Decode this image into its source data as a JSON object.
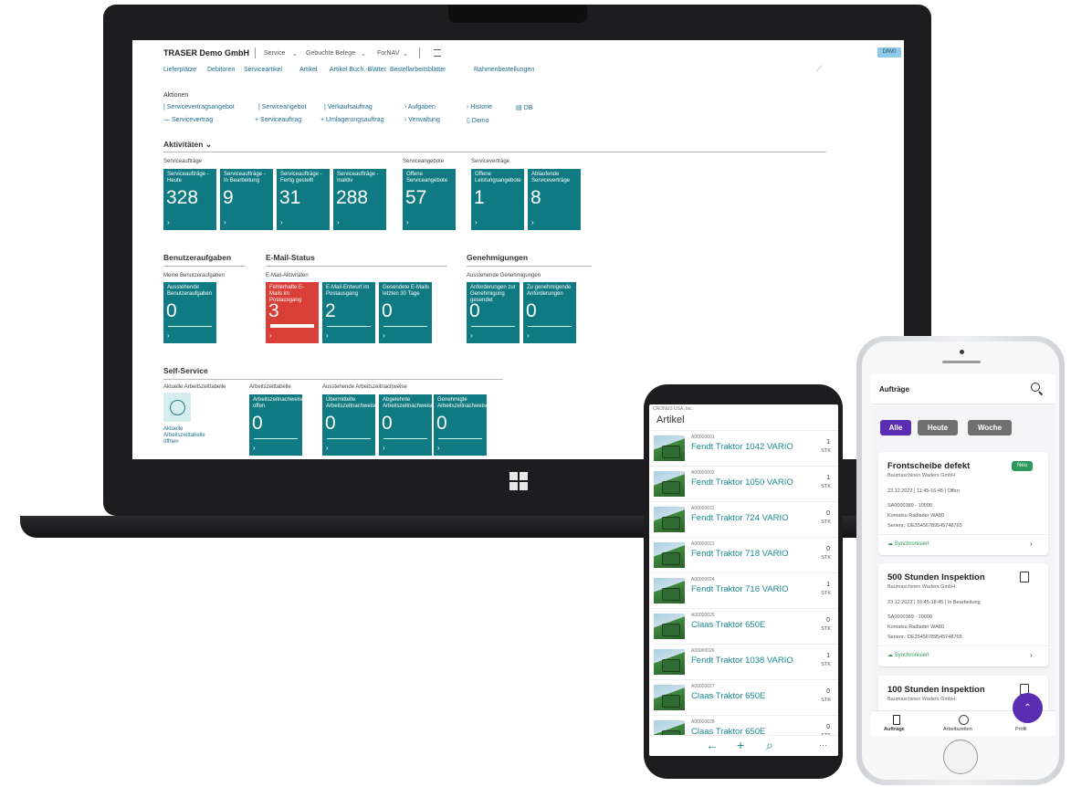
{
  "laptop": {
    "company": "TRASER Demo GmbH",
    "topmenu": [
      "Service",
      "Gebuchte Belege",
      "ForNAV"
    ],
    "badge": "DfW0",
    "navlinks": [
      "Lieferplätze",
      "Debitoren",
      "Serviceartikel",
      "Artikel",
      "Artikel Buch.-Blätter",
      "Bestellarbeitsblätter",
      "Rahmenbestellungen"
    ],
    "actions_title": "Aktionen",
    "actions_row1": [
      "Servicevertragsangebot",
      "Serviceangebot",
      "Verkaufsauftrag",
      "Aufgaben",
      "Historie",
      "DB"
    ],
    "actions_row2": [
      "Servicevertrag",
      "Serviceauftrag",
      "Umlagerungsauftrag",
      "Verwaltung",
      "Demo"
    ],
    "activities_title": "Aktivitäten",
    "groups": {
      "serviceauftraege": "Serviceaufträge",
      "serviceangebote": "Serviceangebote",
      "servicevertraege": "Serviceverträge",
      "meine_aufgaben": "Meine Benutzeraufgaben",
      "email_aktivitaeten": "E-Mail-Aktivitäten",
      "ausstehende_genehmigungen": "Ausstehende Genehmigungen",
      "aktuelle_arbeitszeittabelle": "Aktuelle Arbeitszeittabelle",
      "arbeitszeittabelle": "Arbeitszeittabelle",
      "ausstehende_arbeitszeit": "Ausstehende Arbeitszeitnachweise"
    },
    "tiles_activities": [
      {
        "label": "Serviceaufträge - Heute",
        "value": "328"
      },
      {
        "label": "Serviceaufträge - In Bearbeitung",
        "value": "9"
      },
      {
        "label": "Serviceaufträge - Fertig gestellt",
        "value": "31"
      },
      {
        "label": "Serviceaufträge - Inaktiv",
        "value": "288"
      },
      {
        "label": "Offene Serviceangebote",
        "value": "57"
      },
      {
        "label": "Offene Leistungsangebote",
        "value": "1"
      },
      {
        "label": "Ablaufende Serviceverträge",
        "value": "8"
      }
    ],
    "sec_benutzer": "Benutzeraufgaben",
    "sec_email": "E-Mail-Status",
    "sec_genehm": "Genehmigungen",
    "tiles_row2": [
      {
        "label": "Ausstehende Benutzeraufgaben",
        "value": "0"
      },
      {
        "label": "Fehlerhafte E-Mails im Postausgang",
        "value": "3"
      },
      {
        "label": "E-Mail-Entwurf im Postausgang",
        "value": "2"
      },
      {
        "label": "Gesendete E-Mails letzten 30 Tage",
        "value": "0"
      },
      {
        "label": "Anforderungen zur Genehmigung gesendet",
        "value": "0"
      },
      {
        "label": "Zu genehmigende Anforderungen",
        "value": "0"
      }
    ],
    "sec_self": "Self-Service",
    "ss_link": "Aktuelle Arbeitszeittabelle öffnen",
    "tiles_row3": [
      {
        "label": "Arbeitszeitnachweise offen",
        "value": "0"
      },
      {
        "label": "Übermittelte Arbeitszeitnachweise",
        "value": "0"
      },
      {
        "label": "Abgelehnte Arbeitszeitnachweise",
        "value": "0"
      },
      {
        "label": "Genehmigte Arbeitszeitnachweise",
        "value": "0"
      }
    ],
    "chevron": "›"
  },
  "phone1": {
    "status": "CRONUS USA, Inc.",
    "title": "Artikel",
    "items": [
      {
        "no": "A00000001",
        "name": "Fendt Traktor 1042 VARIO",
        "qty": "1",
        "unit": "STK"
      },
      {
        "no": "A00000002",
        "name": "Fendt Traktor 1050 VARIO",
        "qty": "1",
        "unit": "STK"
      },
      {
        "no": "A00000022",
        "name": "Fendt Traktor 724 VARIO",
        "qty": "0",
        "unit": "STK"
      },
      {
        "no": "A00000023",
        "name": "Fendt Traktor 718 VARIO",
        "qty": "0",
        "unit": "STK"
      },
      {
        "no": "A00000024",
        "name": "Fendt Traktor 716 VARIO",
        "qty": "1",
        "unit": "STK"
      },
      {
        "no": "A00000025",
        "name": "Claas Traktor 650E",
        "qty": "0",
        "unit": "STK"
      },
      {
        "no": "A00000026",
        "name": "Fendt Traktor 1038 VARIO",
        "qty": "1",
        "unit": "STK"
      },
      {
        "no": "A00000027",
        "name": "Claas Traktor 650E",
        "qty": "0",
        "unit": "STK"
      },
      {
        "no": "A00000028",
        "name": "Claas Traktor 650E",
        "qty": "0",
        "unit": "STK"
      }
    ],
    "icons": [
      "←",
      "+",
      "⌕",
      "···"
    ]
  },
  "phone2": {
    "title": "Aufträge",
    "filters": [
      "Alle",
      "Heute",
      "Woche"
    ],
    "colors": {
      "accent": "#5b2db3",
      "chip_inactive": "#707070",
      "sync": "#2e9a5a",
      "teal": "#0f7a82",
      "red": "#d93f37"
    },
    "cards": [
      {
        "title": "Frontscheibe defekt",
        "customer": "Baumaschinen Waders GmbH",
        "time": "23.12.2022 | 11:45-16:45 | Offen",
        "ref": "SA0000389 - 10000",
        "machine": "Komatsu Radlader WA80",
        "serial": "Serienr.: DE35456789545748765",
        "badge": "Neu",
        "sync": "Synchronisiert"
      },
      {
        "title": "500 Stunden Inspektion",
        "customer": "Baumaschinen Waders GmbH",
        "time": "23.12.2022 | 16:45-18:45 | In Bearbeitung",
        "ref": "SA0000389 - 10000",
        "machine": "Komatsu Radlader WA80",
        "serial": "Serienr.: DE35456789545748765",
        "sync": "Synchronisiert"
      },
      {
        "title": "100 Stunden Inspektion",
        "customer": "Baumaschinen Waders GmbH"
      }
    ],
    "nav": [
      "Aufträge",
      "Arbeitszeiten",
      "Profil"
    ]
  }
}
